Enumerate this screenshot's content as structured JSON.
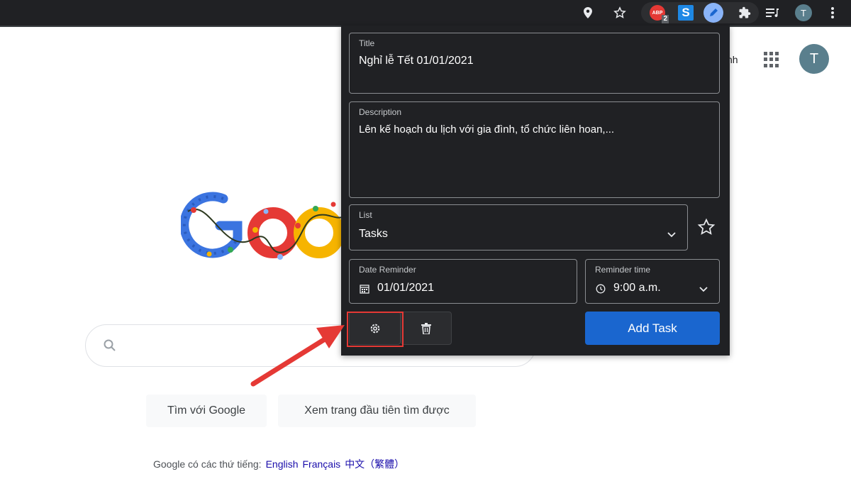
{
  "toolbar": {
    "icons": [
      "location-icon",
      "star-icon",
      "adblock-icon",
      "s-extension-icon",
      "pen-extension-icon",
      "puzzle-icon",
      "reading-list-icon",
      "profile-avatar",
      "menu-dots-icon"
    ],
    "adblock_badge": "2",
    "adblock_letters": "ABP",
    "profile_letter": "T",
    "s_letter": "S"
  },
  "google": {
    "account_link_fragment": "nh",
    "avatar_letter": "T",
    "logo_fragment": "Goo",
    "search_button": "Tìm với Google",
    "lucky_button": "Xem trang đầu tiên tìm được",
    "languages_prefix": "Google có các thứ tiếng:",
    "languages": [
      "English",
      "Français",
      "中文（繁體）"
    ]
  },
  "popup": {
    "title_label": "Title",
    "title_value": "Nghỉ lễ Tết 01/01/2021",
    "description_label": "Description",
    "description_value": "Lên kế hoạch du lịch với gia đình, tổ chức liên hoan,...",
    "list_label": "List",
    "list_value": "Tasks",
    "date_label": "Date Reminder",
    "date_value": "01/01/2021",
    "time_label": "Reminder time",
    "time_value": "9:00 a.m.",
    "add_task_label": "Add Task"
  },
  "colors": {
    "popup_bg": "#202124",
    "accent_blue": "#1a66cf",
    "highlight_red": "#e53935",
    "toolbar_bg": "#202124"
  }
}
